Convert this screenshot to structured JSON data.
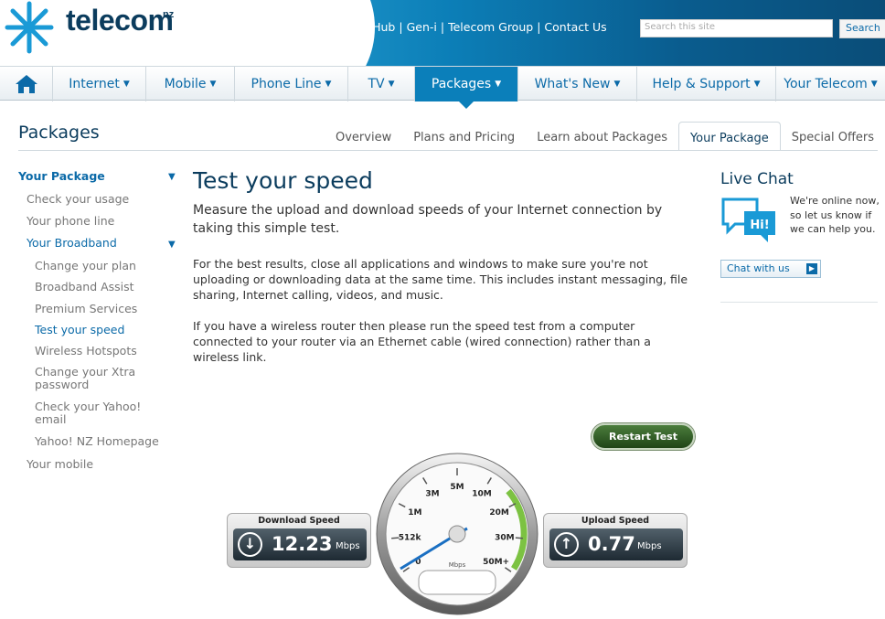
{
  "brand": {
    "name": "telecom",
    "suffix": "nz"
  },
  "toplinks": [
    "Business Hub",
    "Gen-i",
    "Telecom Group",
    "Contact Us"
  ],
  "search": {
    "placeholder": "Search this site",
    "button": "Search"
  },
  "nav": {
    "home_icon": "house-icon",
    "items": [
      {
        "label": "Internet"
      },
      {
        "label": "Mobile"
      },
      {
        "label": "Phone Line"
      },
      {
        "label": "TV"
      },
      {
        "label": "Packages",
        "active": true
      },
      {
        "label": "What's New"
      },
      {
        "label": "Help & Support"
      },
      {
        "label": "Your Telecom"
      }
    ]
  },
  "page_title": "Packages",
  "subtabs": [
    {
      "label": "Overview"
    },
    {
      "label": "Plans and Pricing"
    },
    {
      "label": "Learn about Packages"
    },
    {
      "label": "Your Package",
      "active": true
    },
    {
      "label": "Special Offers"
    }
  ],
  "sidebar": {
    "items": [
      {
        "label": "Your Package"
      },
      {
        "label": "Check your usage"
      },
      {
        "label": "Your phone line"
      },
      {
        "label": "Your Broadband"
      },
      {
        "label": "Change your plan"
      },
      {
        "label": "Broadband Assist"
      },
      {
        "label": "Premium Services"
      },
      {
        "label": "Test your speed"
      },
      {
        "label": "Wireless Hotspots"
      },
      {
        "label": "Change your Xtra password"
      },
      {
        "label": "Check your Yahoo! email"
      },
      {
        "label": "Yahoo! NZ Homepage"
      },
      {
        "label": "Your mobile"
      }
    ]
  },
  "main": {
    "title": "Test your speed",
    "intro": "Measure the upload and download speeds of your Internet connection by taking this simple test.",
    "para1": "For the best results, close all applications and windows to make sure you're not uploading or downloading data at the same time. This includes instant messaging, file sharing, Internet calling, videos, and music.",
    "para2": "If you have a wireless router then please run the speed test from a computer connected to your router via an Ethernet cable (wired connection) rather than a wireless link."
  },
  "live_chat": {
    "title": "Live Chat",
    "icon_text": "Hi!",
    "text": "We're online now, so let us know if we can help you.",
    "button": "Chat with us"
  },
  "speedtest": {
    "restart_label": "Restart Test",
    "download": {
      "label": "Download Speed",
      "value": "12.23",
      "unit": "Mbps"
    },
    "upload": {
      "label": "Upload Speed",
      "value": "0.77",
      "unit": "Mbps"
    },
    "gauge": {
      "ticks": [
        "0",
        "512k",
        "1M",
        "3M",
        "5M",
        "10M",
        "20M",
        "30M",
        "50M+"
      ],
      "unit": "Mbps"
    }
  },
  "colors": {
    "brand_dark": "#0b3c5d",
    "link": "#0b6aa8",
    "nav_active": "#0b7fba",
    "gauge_green": "#7cc242"
  }
}
